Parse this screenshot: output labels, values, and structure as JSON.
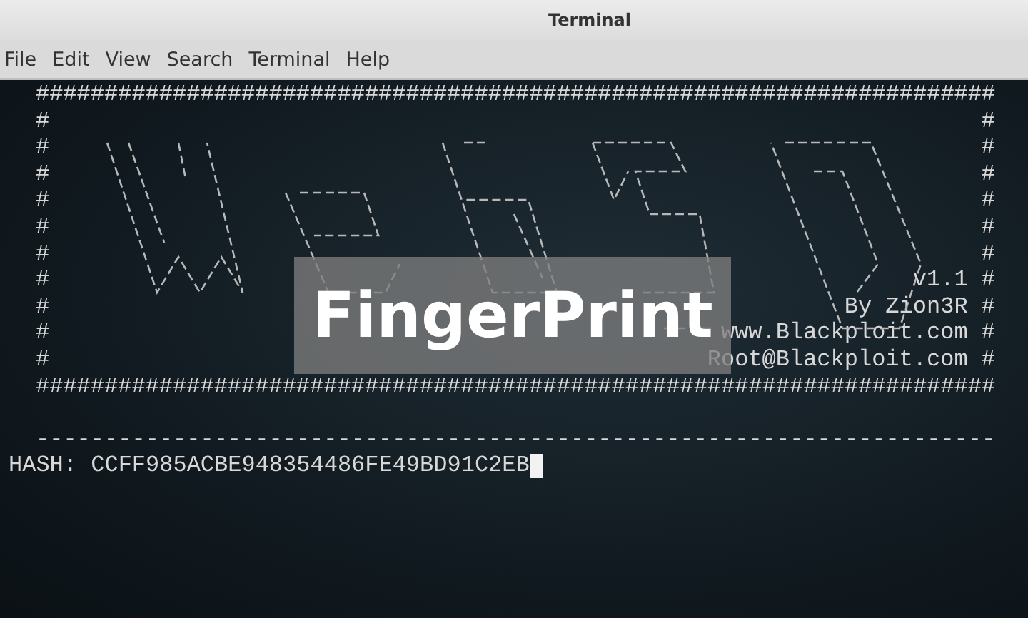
{
  "window": {
    "title": "Terminal"
  },
  "menu": [
    "File",
    "Edit",
    "View",
    "Search",
    "Terminal",
    "Help"
  ],
  "banner": {
    "border": "######################################################################",
    "rows": [
      {
        "left": "#",
        "right": "#"
      },
      {
        "left": "#",
        "right": "#"
      },
      {
        "left": "#",
        "right": "#"
      },
      {
        "left": "#",
        "right": "#"
      },
      {
        "left": "#",
        "right": "#"
      },
      {
        "left": "#",
        "right": "#"
      },
      {
        "left": "#",
        "right": "v1.1 #"
      },
      {
        "left": "#",
        "right": "By Zion3R #"
      },
      {
        "left": "#",
        "right": "www.Blackploit.com #"
      },
      {
        "left": "#",
        "right": "Root@Blackploit.com #"
      }
    ]
  },
  "separator": "----------------------------------------------------------------------",
  "prompt": {
    "text": "HASH: CCFF985ACBE948354486FE49BD91C2EB",
    "cursor": true
  },
  "overlay_caption": "FingerPrint"
}
